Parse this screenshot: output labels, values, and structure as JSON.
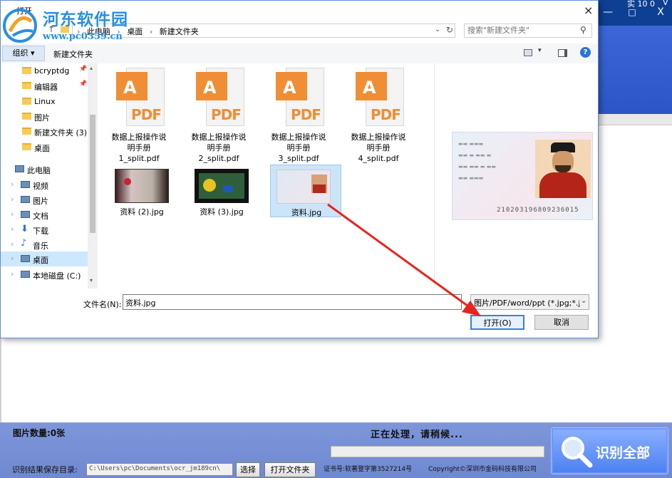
{
  "background_app": {
    "title_fragment": "实 10 0",
    "window_letter": "V",
    "minimize": "—",
    "maximize": "□",
    "close": "X"
  },
  "watermark": {
    "site_name": "河东软件园",
    "url": "www.pc0359.cn"
  },
  "dialog": {
    "title": "打开",
    "close": "×",
    "breadcrumb": [
      "此电脑",
      "桌面",
      "新建文件夹"
    ],
    "search_placeholder": "搜索\"新建文件夹\"",
    "toolbar": {
      "organize": "组织 ▾",
      "new_folder": "新建文件夹",
      "help": "?"
    },
    "nav_items": [
      {
        "label": "bcryptdg",
        "icon": "folder-icon",
        "pinned": true
      },
      {
        "label": "编辑器",
        "icon": "folder-icon",
        "pinned": true
      },
      {
        "label": "Linux",
        "icon": "folder-icon",
        "pinned": false
      },
      {
        "label": "图片",
        "icon": "folder-icon",
        "pinned": false
      },
      {
        "label": "新建文件夹 (3)",
        "icon": "folder-icon",
        "pinned": false
      },
      {
        "label": "桌面",
        "icon": "folder-icon",
        "pinned": false
      },
      {
        "label": "此电脑",
        "icon": "computer-icon",
        "pinned": false
      },
      {
        "label": "视频",
        "icon": "video-icon",
        "pinned": false
      },
      {
        "label": "图片",
        "icon": "picture-icon",
        "pinned": false
      },
      {
        "label": "文档",
        "icon": "document-icon",
        "pinned": false
      },
      {
        "label": "下载",
        "icon": "download-icon",
        "pinned": false
      },
      {
        "label": "音乐",
        "icon": "music-icon",
        "pinned": false
      },
      {
        "label": "桌面",
        "icon": "desktop-icon",
        "pinned": false,
        "selected": true
      },
      {
        "label": "本地磁盘 (C:)",
        "icon": "drive-icon",
        "pinned": false
      }
    ],
    "pdf_files": [
      {
        "line1": "数据上报操作说",
        "line2": "明手册",
        "line3": "1_split.pdf"
      },
      {
        "line1": "数据上报操作说",
        "line2": "明手册",
        "line3": "2_split.pdf"
      },
      {
        "line1": "数据上报操作说",
        "line2": "明手册",
        "line3": "3_split.pdf"
      },
      {
        "line1": "数据上报操作说",
        "line2": "明手册",
        "line3": "4_split.pdf"
      }
    ],
    "pdf_icon_text": "PDF",
    "jpg_files": [
      {
        "name": "资料 (2).jpg",
        "selected": false
      },
      {
        "name": "资料 (3).jpg",
        "selected": false
      },
      {
        "name": "资料.jpg",
        "selected": true
      }
    ],
    "preview": {
      "id_number": "210203196809236015"
    },
    "filename_label": "文件名(N):",
    "filename_value": "资料.jpg",
    "file_type_filter": "图片/PDF/word/ppt (*.jpg;*.j",
    "open_button": "打开(O)",
    "cancel_button": "取消"
  },
  "bottom_panel": {
    "image_count": "图片数量:0张",
    "status": "正在处理，请稍候...",
    "save_dir_label": "识别结果保存目录:",
    "save_dir_value": "C:\\Users\\pc\\Documents\\ocr_jm189cn\\",
    "select_button": "选择",
    "open_folder_button": "打开文件夹",
    "certificate": "证书号:软著登字第3527214号",
    "copyright": "Copyright©深圳市金码科技有限公司",
    "recognize_all_button": "识别全部",
    "progress": 0
  },
  "colors": {
    "accent_blue": "#2c55c8",
    "arrow_red": "#e8231e",
    "pdf_orange": "#f08e36"
  }
}
